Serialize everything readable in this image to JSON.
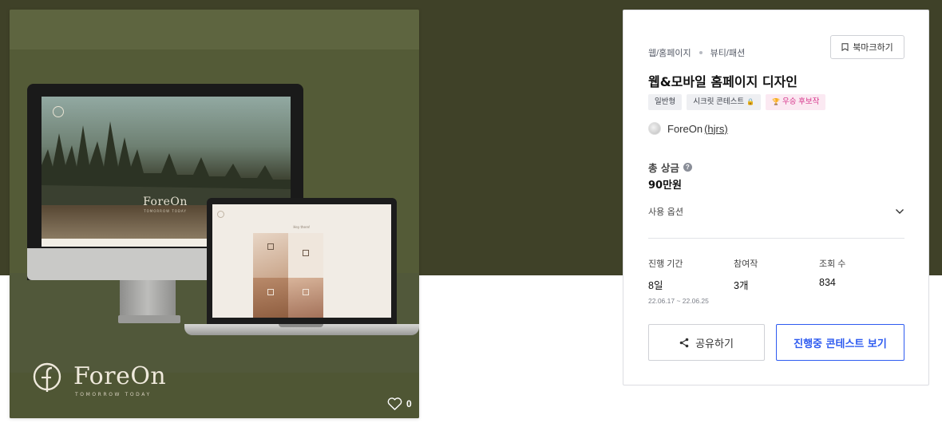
{
  "thumbnail": {
    "screen_brand": "ForeOn",
    "screen_brand_sub": "TOMORROW TODAY",
    "laptop_heading": "Hey there!",
    "brand_name": "ForeOn",
    "brand_tagline": "TOMORROW TODAY",
    "like_count": "0",
    "icons": {
      "like": "heart-icon",
      "logo": "foreon-logo-icon"
    }
  },
  "info": {
    "breadcrumb": [
      "웹/홈페이지",
      "뷰티/패션"
    ],
    "bookmark_label": "북마크하기",
    "title": "웹&모바일 홈페이지 디자인",
    "tags": [
      {
        "label": "일반형",
        "style": "gray"
      },
      {
        "label": "시크릿 콘테스트",
        "emoji": "🔒",
        "style": "gray"
      },
      {
        "label": "우승 후보작",
        "emoji": "🏆",
        "style": "pink"
      }
    ],
    "owner": {
      "name": "ForeOn",
      "handle": "(hjrs)"
    },
    "prize_label": "총 상금",
    "help_glyph": "?",
    "prize_value": "90만원",
    "options_label": "사용 옵션",
    "stats": {
      "period": {
        "label": "진행 기간",
        "value": "8일",
        "sub": "22.06.17 ~ 22.06.25"
      },
      "participants": {
        "label": "참여작",
        "value": "3개"
      },
      "views": {
        "label": "조회 수",
        "value": "834"
      }
    },
    "share_label": "공유하기",
    "ongoing_label": "진행중 콘테스트 보기",
    "colors": {
      "hero_band": "#3f4128",
      "accent_blue": "#2e5bf0",
      "pink_tag_text": "#d6338a",
      "pink_tag_bg": "#fbe9f2"
    }
  }
}
